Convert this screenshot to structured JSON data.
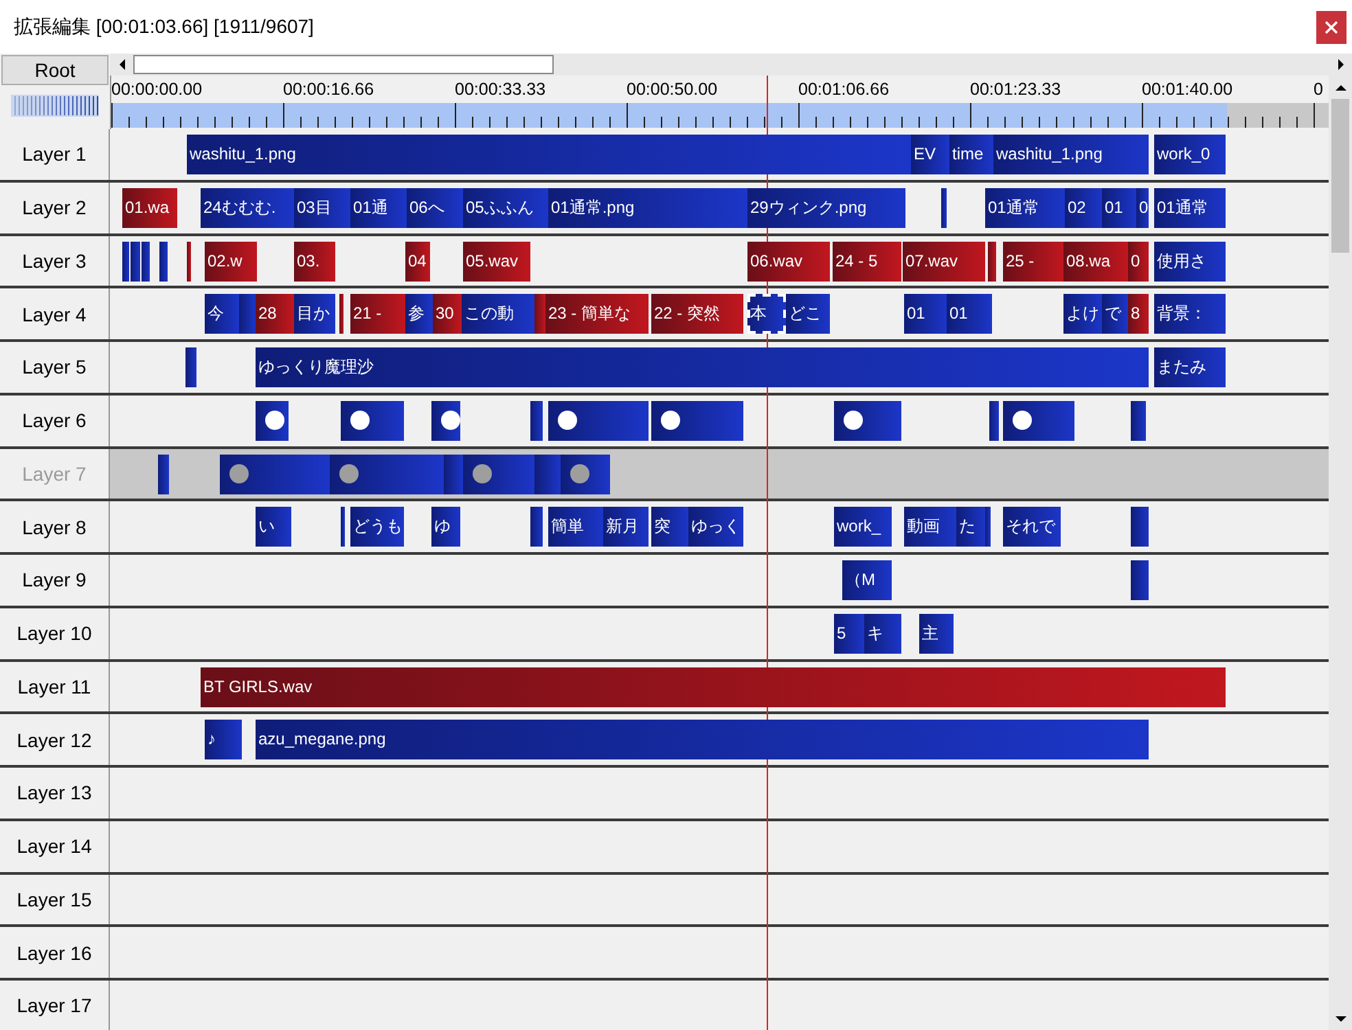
{
  "window": {
    "title": "拡張編集 [00:01:03.66] [1911/9607]"
  },
  "root_button": "Root",
  "ruler": {
    "labels": [
      "00:00:00.00",
      "00:00:16.66",
      "00:00:33.33",
      "00:00:50.00",
      "00:01:06.66",
      "00:01:23.33",
      "00:01:40.00",
      "0"
    ]
  },
  "layers": [
    {
      "name": "Layer 1",
      "disabled": false,
      "clips": [
        {
          "label": "washitu_1.png",
          "kind": "media",
          "selected": false
        },
        {
          "label": "EV",
          "kind": "media",
          "selected": false
        },
        {
          "label": "time",
          "kind": "media",
          "selected": false
        },
        {
          "label": "washitu_1.png",
          "kind": "media",
          "selected": false
        },
        {
          "label": "work_0",
          "kind": "media",
          "selected": false
        }
      ]
    },
    {
      "name": "Layer 2",
      "disabled": false,
      "clips": [
        {
          "label": "01.wa",
          "kind": "audio",
          "selected": false
        },
        {
          "label": "24むむむ.",
          "kind": "media",
          "selected": false
        },
        {
          "label": "03目",
          "kind": "media",
          "selected": false
        },
        {
          "label": "01通",
          "kind": "media",
          "selected": false
        },
        {
          "label": "06へ",
          "kind": "media",
          "selected": false
        },
        {
          "label": "05ふふん",
          "kind": "media",
          "selected": false
        },
        {
          "label": "01通常.png",
          "kind": "media",
          "selected": false
        },
        {
          "label": "29ウィンク.png",
          "kind": "media",
          "selected": false
        },
        {
          "kind": "media",
          "selected": false
        },
        {
          "label": "01通常",
          "kind": "media",
          "selected": false
        },
        {
          "label": "02",
          "kind": "media",
          "selected": false
        },
        {
          "label": "01",
          "kind": "media",
          "selected": false
        },
        {
          "label": "0",
          "kind": "media",
          "selected": false
        },
        {
          "label": "01通常",
          "kind": "media",
          "selected": false
        }
      ]
    },
    {
      "name": "Layer 3",
      "disabled": false,
      "clips": [
        {
          "kind": "media",
          "selected": false
        },
        {
          "kind": "media",
          "selected": false
        },
        {
          "kind": "media",
          "selected": false
        },
        {
          "kind": "media",
          "selected": false
        },
        {
          "kind": "audio",
          "selected": false
        },
        {
          "label": "02.w",
          "kind": "audio",
          "selected": false
        },
        {
          "label": "03.",
          "kind": "audio",
          "selected": false
        },
        {
          "label": "04",
          "kind": "audio",
          "selected": false
        },
        {
          "label": "05.wav",
          "kind": "audio",
          "selected": false
        },
        {
          "label": "06.wav",
          "kind": "audio",
          "selected": false
        },
        {
          "label": "24 - 5",
          "kind": "audio",
          "selected": false
        },
        {
          "label": "07.wav",
          "kind": "audio",
          "selected": false
        },
        {
          "kind": "audio",
          "selected": false
        },
        {
          "label": "25 -",
          "kind": "audio",
          "selected": false
        },
        {
          "label": "08.wa",
          "kind": "audio",
          "selected": false
        },
        {
          "label": "0",
          "kind": "audio",
          "selected": false
        },
        {
          "label": "使用さ",
          "kind": "media",
          "selected": false
        }
      ]
    },
    {
      "name": "Layer 4",
      "disabled": false,
      "clips": [
        {
          "label": "今",
          "kind": "media",
          "selected": false
        },
        {
          "kind": "media",
          "selected": false
        },
        {
          "label": "28",
          "kind": "audio",
          "selected": false
        },
        {
          "label": "目か",
          "kind": "media",
          "selected": false
        },
        {
          "kind": "audio",
          "selected": false
        },
        {
          "label": "21 -",
          "kind": "audio",
          "selected": false
        },
        {
          "label": "参",
          "kind": "media",
          "selected": false
        },
        {
          "label": "30",
          "kind": "audio",
          "selected": false
        },
        {
          "label": "この動",
          "kind": "media",
          "selected": false
        },
        {
          "kind": "audio",
          "selected": false
        },
        {
          "label": "23 - 簡単な",
          "kind": "audio",
          "selected": false
        },
        {
          "label": "22 - 突然",
          "kind": "audio",
          "selected": false
        },
        {
          "label": "本",
          "kind": "media",
          "selected": true
        },
        {
          "label": "どこ",
          "kind": "media",
          "selected": false
        },
        {
          "label": "01",
          "kind": "media",
          "selected": false
        },
        {
          "label": "01",
          "kind": "media",
          "selected": false
        },
        {
          "label": "よけ",
          "kind": "media",
          "selected": false
        },
        {
          "label": "で",
          "kind": "media",
          "selected": false
        },
        {
          "label": "8",
          "kind": "audio",
          "selected": false
        },
        {
          "label": "背景：",
          "kind": "media",
          "selected": false
        }
      ]
    },
    {
      "name": "Layer 5",
      "disabled": false,
      "clips": [
        {
          "kind": "media",
          "selected": false
        },
        {
          "label": "ゆっくり魔理沙",
          "kind": "media",
          "selected": false
        },
        {
          "label": "またみ",
          "kind": "media",
          "selected": false
        }
      ]
    },
    {
      "name": "Layer 6",
      "disabled": false,
      "clips": [
        {
          "kind": "dot",
          "selected": false
        },
        {
          "kind": "dot",
          "selected": false
        },
        {
          "kind": "dot",
          "selected": false
        },
        {
          "kind": "media",
          "selected": false
        },
        {
          "kind": "dot",
          "selected": false
        },
        {
          "kind": "dot",
          "selected": false
        },
        {
          "kind": "dot",
          "selected": false
        },
        {
          "kind": "media",
          "selected": false
        },
        {
          "kind": "dot",
          "selected": false
        },
        {
          "kind": "media",
          "selected": false
        }
      ]
    },
    {
      "name": "Layer 7",
      "disabled": true,
      "clips": [
        {
          "kind": "media",
          "selected": false
        },
        {
          "kind": "dot",
          "selected": false
        },
        {
          "kind": "dot",
          "selected": false
        },
        {
          "kind": "media",
          "selected": false
        },
        {
          "kind": "dot",
          "selected": false
        },
        {
          "kind": "media",
          "selected": false
        },
        {
          "kind": "dot",
          "selected": false
        }
      ]
    },
    {
      "name": "Layer 8",
      "disabled": false,
      "clips": [
        {
          "label": "い",
          "kind": "media",
          "selected": false
        },
        {
          "kind": "media",
          "selected": false
        },
        {
          "label": "どうも",
          "kind": "media",
          "selected": false
        },
        {
          "label": "ゆ",
          "kind": "media",
          "selected": false
        },
        {
          "kind": "media",
          "selected": false
        },
        {
          "label": "簡単",
          "kind": "media",
          "selected": false
        },
        {
          "label": "新月",
          "kind": "media",
          "selected": false
        },
        {
          "label": "突",
          "kind": "media",
          "selected": false
        },
        {
          "label": "ゆっく",
          "kind": "media",
          "selected": false
        },
        {
          "label": "work_",
          "kind": "media",
          "selected": false
        },
        {
          "label": "動画",
          "kind": "media",
          "selected": false
        },
        {
          "label": "た",
          "kind": "media",
          "selected": false
        },
        {
          "kind": "media",
          "selected": false
        },
        {
          "label": "それで",
          "kind": "media",
          "selected": false
        },
        {
          "kind": "media",
          "selected": false
        }
      ]
    },
    {
      "name": "Layer 9",
      "disabled": false,
      "clips": [
        {
          "label": "（M",
          "kind": "media",
          "selected": false
        },
        {
          "kind": "media",
          "selected": false
        }
      ]
    },
    {
      "name": "Layer 10",
      "disabled": false,
      "clips": [
        {
          "label": "5",
          "kind": "media",
          "selected": false
        },
        {
          "label": "キ",
          "kind": "media",
          "selected": false
        },
        {
          "label": "主",
          "kind": "media",
          "selected": false
        }
      ]
    },
    {
      "name": "Layer 11",
      "disabled": false,
      "clips": [
        {
          "label": "BT GIRLS.wav",
          "kind": "audio",
          "selected": false
        }
      ]
    },
    {
      "name": "Layer 12",
      "disabled": false,
      "clips": [
        {
          "label": "♪",
          "kind": "media",
          "selected": false
        },
        {
          "label": "azu_megane.png",
          "kind": "media",
          "selected": false
        }
      ]
    },
    {
      "name": "Layer 13",
      "disabled": false
    },
    {
      "name": "Layer 14",
      "disabled": false
    },
    {
      "name": "Layer 15",
      "disabled": false
    },
    {
      "name": "Layer 16",
      "disabled": false
    },
    {
      "name": "Layer 17",
      "disabled": false
    }
  ]
}
